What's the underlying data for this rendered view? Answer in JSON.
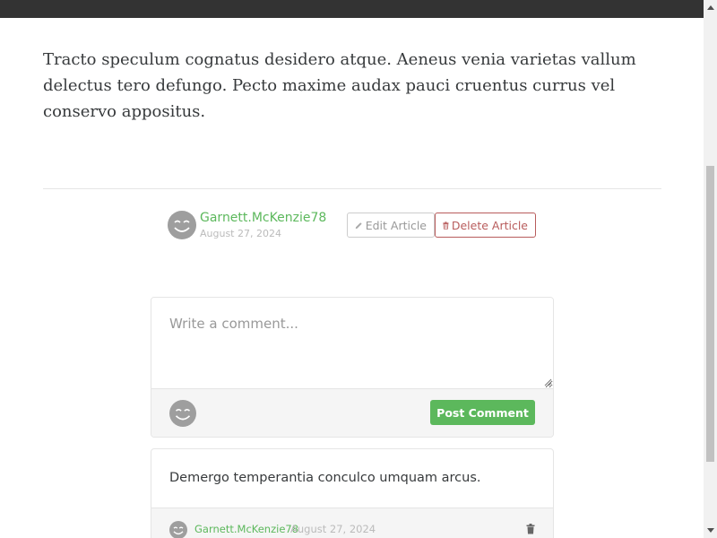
{
  "article": {
    "body": "Tracto speculum cognatus desidero atque. Aeneus venia varietas vallum delectus tero defungo. Pecto maxime audax pauci cruentus currus vel conservo appositus.",
    "author": "Garnett.McKenzie78",
    "date": "August 27, 2024",
    "edit_label": "Edit Article",
    "delete_label": "Delete Article"
  },
  "comment_form": {
    "placeholder": "Write a comment...",
    "value": "",
    "post_label": "Post Comment"
  },
  "comments": [
    {
      "text": "Demergo temperantia conculco umquam arcus.",
      "author": "Garnett.McKenzie78",
      "date": "August 27, 2024"
    }
  ],
  "colors": {
    "accent": "#5cb85c",
    "danger": "#b85c5c",
    "topbar": "#333333"
  },
  "icons": {
    "avatar": "smiley-avatar-icon",
    "edit": "pencil-icon",
    "delete": "trash-icon"
  }
}
